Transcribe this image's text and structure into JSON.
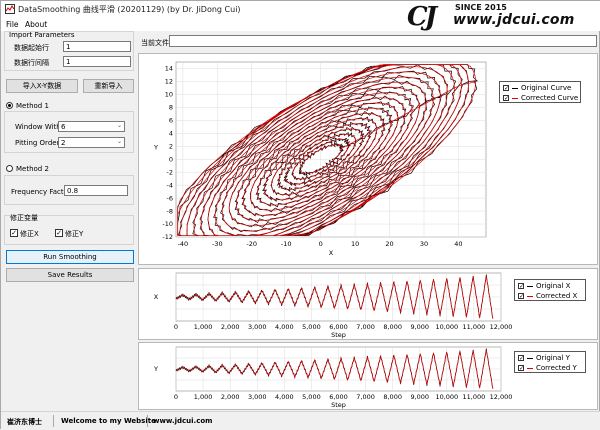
{
  "window": {
    "title": "DataSmoothing 曲线平滑 (20201129) (by Dr. JiDong Cui)"
  },
  "menu": {
    "file": "File",
    "about": "About"
  },
  "logo": {
    "mark": "CJ",
    "since": "SINCE 2015",
    "url": "www.jdcui.com"
  },
  "import": {
    "group_title": "Import Parameters",
    "start_row_label": "数据起始行",
    "start_row_value": "1",
    "row_interval_label": "数据行间隔",
    "row_interval_value": "1",
    "import_xy_label": "导入X-Y数据",
    "reimport_label": "重新导入"
  },
  "method1": {
    "label": "Method 1",
    "window_label": "Window With",
    "window_value": "6",
    "order_label": "Pitting Order",
    "order_value": "2"
  },
  "method2": {
    "label": "Method 2",
    "freq_label": "Frequency Factor",
    "freq_value": "0.8"
  },
  "correct": {
    "group_title": "修正变量",
    "x_label": "修正X",
    "y_label": "修正Y"
  },
  "actions": {
    "run_label": "Run Smoothing",
    "save_label": "Save Results"
  },
  "path": {
    "label": "当前文件",
    "value": ""
  },
  "status": {
    "author": "崔济东博士",
    "welcome": "Welcome to my Website",
    "site": "www.jdcui.com"
  },
  "colors": {
    "original": "#000000",
    "corrected": "#e00000",
    "grid": "#dcdcdc"
  },
  "chart_data": [
    {
      "type": "line",
      "xlabel": "X",
      "ylabel": "Y",
      "xlim": [
        -42,
        48
      ],
      "ylim": [
        -12,
        15
      ],
      "xticks": [
        "-40",
        "-30",
        "-20",
        "-10",
        "0",
        "10",
        "20",
        "30",
        "40"
      ],
      "yticks": [
        "-12",
        "-10",
        "-8",
        "-6",
        "-4",
        "-2",
        "0",
        "2",
        "4",
        "6",
        "8",
        "10",
        "12",
        "14"
      ],
      "series": [
        {
          "name": "Original Curve",
          "color": "#000000"
        },
        {
          "name": "Corrected Curve",
          "color": "#e00000"
        }
      ],
      "legend": "top-right",
      "grid": true
    },
    {
      "type": "line",
      "xlabel": "Step",
      "ylabel": "X",
      "xlim": [
        0,
        12000
      ],
      "xticks": [
        "0",
        "1,000",
        "2,000",
        "3,000",
        "4,000",
        "5,000",
        "6,000",
        "7,000",
        "8,000",
        "9,000",
        "10,000",
        "11,000",
        "12,000"
      ],
      "series": [
        {
          "name": "Original X",
          "color": "#000000"
        },
        {
          "name": "Corrected X",
          "color": "#e00000"
        }
      ],
      "legend": "right",
      "grid": true
    },
    {
      "type": "line",
      "xlabel": "Step",
      "ylabel": "Y",
      "xlim": [
        0,
        12000
      ],
      "xticks": [
        "0",
        "1,000",
        "2,000",
        "3,000",
        "4,000",
        "5,000",
        "6,000",
        "7,000",
        "8,000",
        "9,000",
        "10,000",
        "11,000",
        "12,000"
      ],
      "series": [
        {
          "name": "Original Y",
          "color": "#000000"
        },
        {
          "name": "Corrected Y",
          "color": "#e00000"
        }
      ],
      "legend": "right",
      "grid": true
    }
  ]
}
